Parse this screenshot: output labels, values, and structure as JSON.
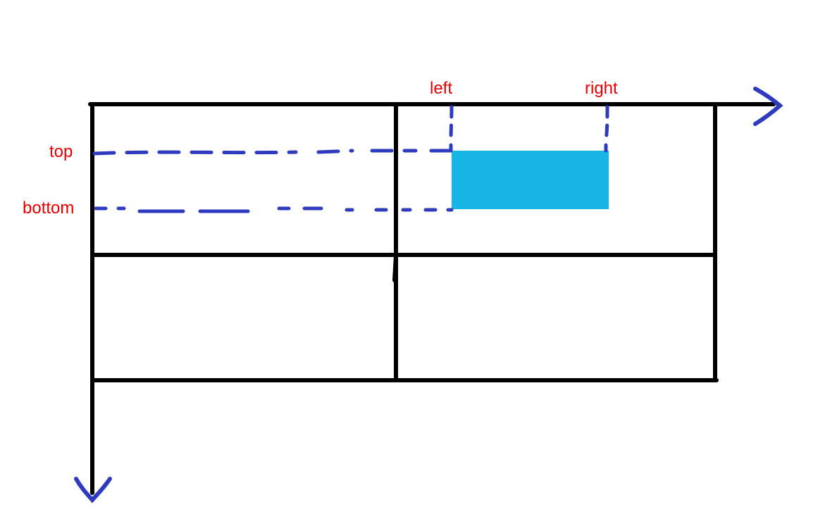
{
  "labels": {
    "left": "left",
    "right": "right",
    "top": "top",
    "bottom": "bottom"
  },
  "colors": {
    "stroke": "#000000",
    "dash": "#2e3bbf",
    "arrow": "#2e3bbf",
    "fill": "#18b6e6",
    "label": "#e80000"
  },
  "geometry_note": "Hand-drawn coordinate diagram. X axis (→) along top edge of a 2×2 grid of rectangular cells, Y axis (↓) along left edge. A solid blue rectangle sits inside the upper-right cell. Dashed blue guide lines project its edges out to the axes: horizontal dashes to the Y axis labelled top / bottom, short vertical dashes up to the X axis labelled left / right."
}
